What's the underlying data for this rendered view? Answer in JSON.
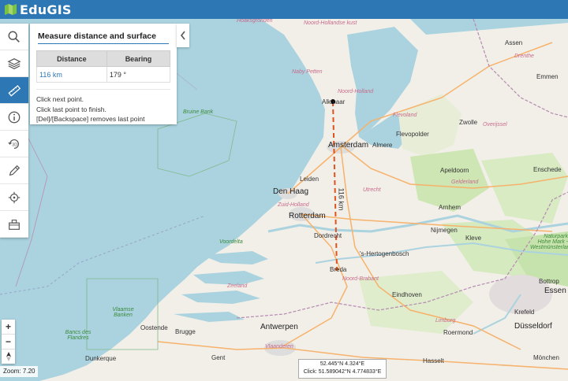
{
  "app": {
    "title": "EduGIS"
  },
  "toolbar": {
    "tools": [
      {
        "name": "search"
      },
      {
        "name": "layers"
      },
      {
        "name": "measure",
        "active": true
      },
      {
        "name": "info"
      },
      {
        "name": "3d"
      },
      {
        "name": "draw"
      },
      {
        "name": "locate"
      },
      {
        "name": "print"
      }
    ],
    "tool_3d_label": "3D"
  },
  "measure_panel": {
    "title": "Measure distance and surface",
    "columns": [
      "Distance",
      "Bearing"
    ],
    "rows": [
      {
        "distance": "116 km",
        "bearing": "179 °"
      }
    ],
    "instructions": [
      "Click next point.",
      "Click last point to finish.",
      "[Del]/[Backspace] removes last point"
    ]
  },
  "map": {
    "measure_label": "116 km",
    "labels": {
      "hoaksgronden": "Hoaksgronden",
      "noordhollandkust": "Noord-Hollandse kust",
      "nabypetten": "Naby Petten",
      "noordholland": "Noord-Holland",
      "bruinebank": "Bruine Bank",
      "alkmaar": "Alkmaar",
      "amsterdam": "Amsterdam",
      "almere": "Almere",
      "flevoland": "Flevoland",
      "flevopolder": "Flevopolder",
      "zwolle": "Zwolle",
      "overijssel": "Overijssel",
      "assen": "Assen",
      "drenthe": "Drenthe",
      "emmen": "Emmen",
      "leiden": "Leiden",
      "denhaag": "Den Haag",
      "zuidholland": "Zuid-Holland",
      "rotterdam": "Rotterdam",
      "utrecht": "Utrecht",
      "apeldoorn": "Apeldoorn",
      "gelderland": "Gelderland",
      "enschede": "Enschede",
      "arnhem": "Arnhem",
      "dordrecht": "Dordrecht",
      "nijmegen": "Nijmegen",
      "kleve": "Kleve",
      "voordelta": "Voordelta",
      "shertogenbosch": "'s-Hertogenbosch",
      "breda": "Breda",
      "noordbrabant": "Noord-Brabant",
      "naturpark": "Naturpark Hohe Mark - Westmünsterland",
      "zeeland": "Zeeland",
      "eindhoven": "Eindhoven",
      "bottrop": "Bottrop",
      "essen": "Essen",
      "krefeld": "Krefeld",
      "vlaamsebanken": "Vlaamse Banken",
      "oostende": "Oostende",
      "brugge": "Brugge",
      "bancsdesflandres": "Bancs des Flandres",
      "antwerpen": "Antwerpen",
      "limburg": "Limburg",
      "roermond": "Roermond",
      "dusseldorf": "Düsseldorf",
      "vlaanderen": "Vlaanderen",
      "dunkerque": "Dunkerque",
      "gent": "Gent",
      "hasselt": "Hasselt",
      "monchen": "Mönchen"
    }
  },
  "zoom": {
    "in": "+",
    "out": "−",
    "label": "Zoom:",
    "value": "7.20"
  },
  "coords": {
    "cursor": "52.445°N 4.324°E",
    "click": "Click: 51.589042°N 4.774833°E"
  },
  "colors": {
    "header": "#2e77b5",
    "sea": "#aad3df",
    "land": "#f2efe9",
    "measure_line": "#e0531c"
  }
}
